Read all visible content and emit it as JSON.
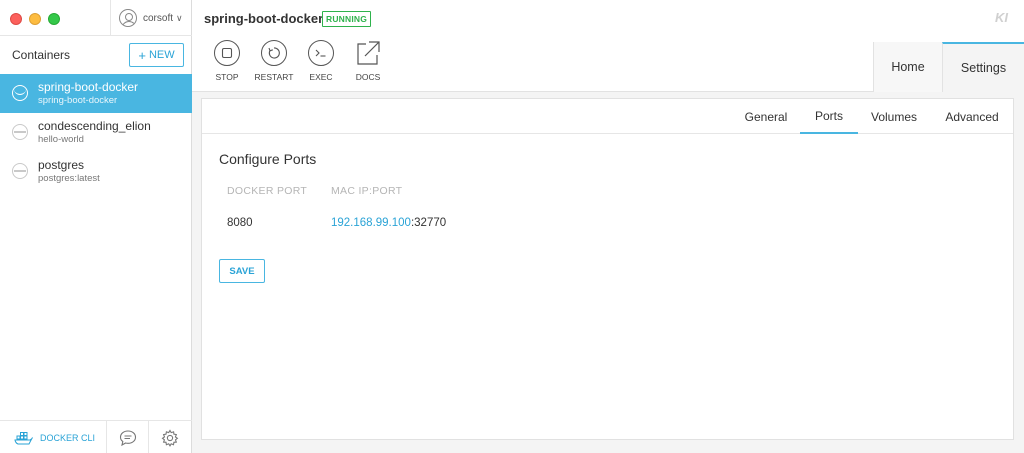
{
  "window": {
    "user": {
      "name": "corsoft",
      "chevron": "∨"
    }
  },
  "sidebar": {
    "title": "Containers",
    "new_button": {
      "icon": "+",
      "label": "NEW"
    },
    "containers": [
      {
        "name": "spring-boot-docker",
        "image": "spring-boot-docker",
        "active": true
      },
      {
        "name": "condescending_elion",
        "image": "hello-world",
        "active": false
      },
      {
        "name": "postgres",
        "image": "postgres:latest",
        "active": false
      }
    ],
    "footer": {
      "cli_label": "DOCKER CLI"
    }
  },
  "main": {
    "container_title": "spring-boot-docker",
    "status": "RUNNING",
    "logo": "KI",
    "actions": [
      {
        "label": "STOP",
        "icon": "stop-icon"
      },
      {
        "label": "RESTART",
        "icon": "restart-icon"
      },
      {
        "label": "EXEC",
        "icon": "terminal-icon"
      },
      {
        "label": "DOCS",
        "icon": "external-link-icon"
      }
    ],
    "tabs": [
      {
        "label": "Home",
        "active": false
      },
      {
        "label": "Settings",
        "active": true
      }
    ],
    "subtabs": [
      {
        "label": "General",
        "active": false
      },
      {
        "label": "Ports",
        "active": true
      },
      {
        "label": "Volumes",
        "active": false
      },
      {
        "label": "Advanced",
        "active": false
      }
    ],
    "ports": {
      "title": "Configure Ports",
      "headers": [
        "DOCKER PORT",
        "MAC IP:PORT"
      ],
      "rows": [
        {
          "docker_port": "8080",
          "ip": "192.168.99.100",
          "host_port": ":32770"
        }
      ],
      "save_label": "SAVE"
    }
  },
  "colors": {
    "accent": "#49b6e1",
    "running": "#2fb24c"
  }
}
